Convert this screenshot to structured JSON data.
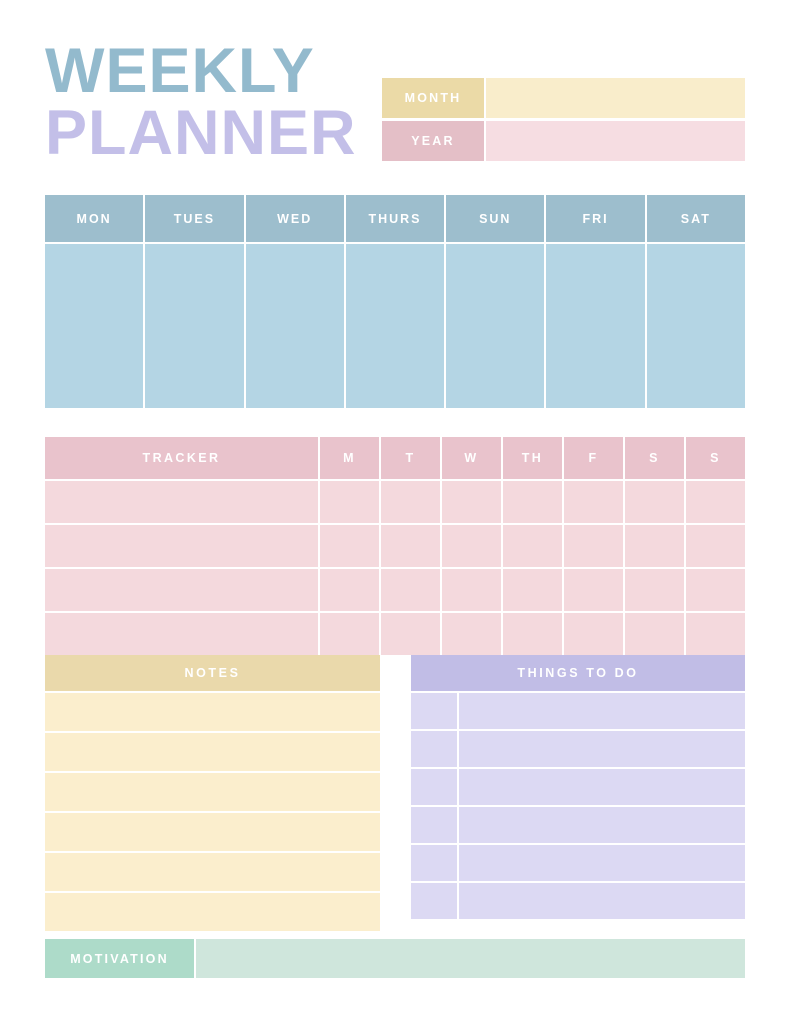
{
  "title": {
    "line1": "WEEKLY",
    "line2": "PLANNER",
    "color1": "#93bacd",
    "color2": "#c3bfe8"
  },
  "month_year": {
    "month_label": "MONTH",
    "month_value": "",
    "year_label": "YEAR",
    "year_value": "",
    "month_label_color": "#ebdaa7",
    "month_field_color": "#f9edcb",
    "year_label_color": "#e4bfc7",
    "year_field_color": "#f6dde2"
  },
  "week": {
    "header_color": "#9dbecd",
    "body_color": "#b4d5e4",
    "days": [
      {
        "label": "MON",
        "content": ""
      },
      {
        "label": "TUES",
        "content": ""
      },
      {
        "label": "WED",
        "content": ""
      },
      {
        "label": "THURS",
        "content": ""
      },
      {
        "label": "SUN",
        "content": ""
      },
      {
        "label": "FRI",
        "content": ""
      },
      {
        "label": "SAT",
        "content": ""
      }
    ]
  },
  "tracker": {
    "title": "TRACKER",
    "header_color": "#e9c3cc",
    "body_color": "#f4d9dd",
    "day_headers": [
      "M",
      "T",
      "W",
      "TH",
      "F",
      "S",
      "S"
    ],
    "rows": [
      {
        "name": "",
        "marks": [
          "",
          "",
          "",
          "",
          "",
          "",
          ""
        ]
      },
      {
        "name": "",
        "marks": [
          "",
          "",
          "",
          "",
          "",
          "",
          ""
        ]
      },
      {
        "name": "",
        "marks": [
          "",
          "",
          "",
          "",
          "",
          "",
          ""
        ]
      },
      {
        "name": "",
        "marks": [
          "",
          "",
          "",
          "",
          "",
          "",
          ""
        ]
      }
    ]
  },
  "notes": {
    "title": "NOTES",
    "header_color": "#ead9ab",
    "body_color": "#fbeecd",
    "lines": [
      "",
      "",
      "",
      "",
      "",
      ""
    ]
  },
  "todo": {
    "title": "THINGS TO DO",
    "header_color": "#c1bde6",
    "body_color": "#dcd9f3",
    "items": [
      {
        "checked": "",
        "text": ""
      },
      {
        "checked": "",
        "text": ""
      },
      {
        "checked": "",
        "text": ""
      },
      {
        "checked": "",
        "text": ""
      },
      {
        "checked": "",
        "text": ""
      },
      {
        "checked": "",
        "text": ""
      }
    ]
  },
  "motivation": {
    "label": "MOTIVATION",
    "value": "",
    "label_color": "#addbc9",
    "field_color": "#cfe6dc"
  }
}
